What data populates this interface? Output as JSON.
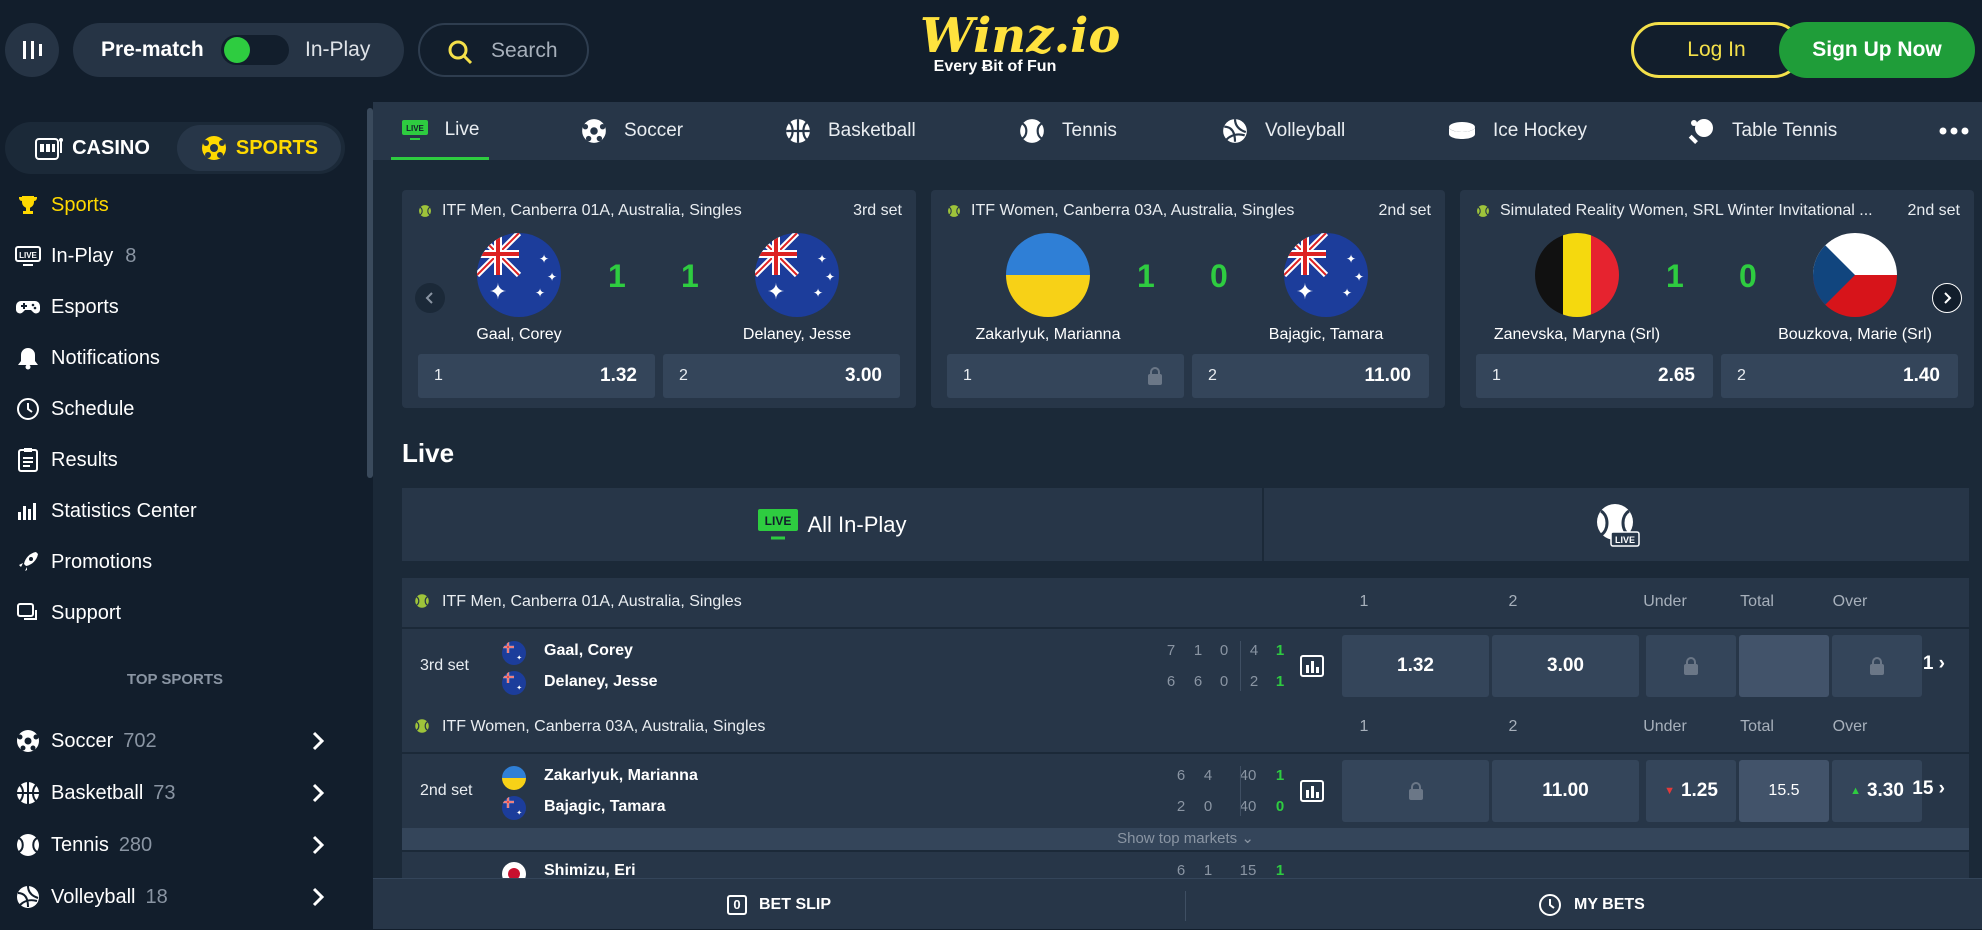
{
  "header": {
    "prematch_label": "Pre-match",
    "inplay_label": "In-Play",
    "search_label": "Search",
    "logo_text": "Winz.io",
    "logo_tagline": "Every Ƀit of Fun",
    "login_label": "Log In",
    "signup_label": "Sign Up Now"
  },
  "sidebar": {
    "casino_label": "CASINO",
    "sports_label": "SPORTS",
    "items": [
      {
        "label": "Sports",
        "count": ""
      },
      {
        "label": "In-Play",
        "count": "8"
      },
      {
        "label": "Esports",
        "count": ""
      },
      {
        "label": "Notifications",
        "count": ""
      },
      {
        "label": "Schedule",
        "count": ""
      },
      {
        "label": "Results",
        "count": ""
      },
      {
        "label": "Statistics Center",
        "count": ""
      },
      {
        "label": "Promotions",
        "count": ""
      },
      {
        "label": "Support",
        "count": ""
      }
    ],
    "top_sports_title": "TOP SPORTS",
    "top_sports": [
      {
        "label": "Soccer",
        "count": "702"
      },
      {
        "label": "Basketball",
        "count": "73"
      },
      {
        "label": "Tennis",
        "count": "280"
      },
      {
        "label": "Volleyball",
        "count": "18"
      }
    ]
  },
  "sport_nav": [
    "Live",
    "Soccer",
    "Basketball",
    "Tennis",
    "Volleyball",
    "Ice Hockey",
    "Table Tennis"
  ],
  "featured": [
    {
      "league": "ITF Men, Canberra 01A, Australia, Singles",
      "set": "3rd set",
      "p1": "Gaal, Corey",
      "p2": "Delaney, Jesse",
      "s1": "1",
      "s2": "1",
      "o1n": "1",
      "o1": "1.32",
      "o2n": "2",
      "o2": "3.00"
    },
    {
      "league": "ITF Women, Canberra 03A, Australia, Singles",
      "set": "2nd set",
      "p1": "Zakarlyuk, Marianna",
      "p2": "Bajagic, Tamara",
      "s1": "1",
      "s2": "0",
      "o1n": "1",
      "o1": "",
      "o2n": "2",
      "o2": "11.00"
    },
    {
      "league": "Simulated Reality Women, SRL Winter Invitational ...",
      "set": "2nd set",
      "p1": "Zanevska, Maryna (Srl)",
      "p2": "Bouzkova, Marie (Srl)",
      "s1": "1",
      "s2": "0",
      "o1n": "1",
      "o1": "2.65",
      "o2n": "2",
      "o2": "1.40"
    }
  ],
  "live_section": {
    "title": "Live",
    "all_inplay_label": "All In-Play",
    "live_badge": "LIVE",
    "col_1": "1",
    "col_2": "2",
    "col_under": "Under",
    "col_total": "Total",
    "col_over": "Over",
    "matches": [
      {
        "league": "ITF Men, Canberra 01A, Australia, Singles",
        "set": "3rd set",
        "p1": "Gaal, Corey",
        "p2": "Delaney, Jesse",
        "p1_scores": [
          "7",
          "1",
          "0",
          "4",
          "1"
        ],
        "p2_scores": [
          "6",
          "6",
          "0",
          "2",
          "1"
        ],
        "odd1": "1.32",
        "odd2": "3.00",
        "under": "",
        "total": "",
        "over": "",
        "more": "1"
      },
      {
        "league": "ITF Women, Canberra 03A, Australia, Singles",
        "set": "2nd set",
        "p1": "Zakarlyuk, Marianna",
        "p2": "Bajagic, Tamara",
        "p1_scores": [
          "6",
          "4",
          "40",
          "1"
        ],
        "p2_scores": [
          "2",
          "0",
          "40",
          "0"
        ],
        "odd1": "",
        "odd2": "11.00",
        "under": "1.25",
        "total": "15.5",
        "over": "3.30",
        "more": "15"
      }
    ],
    "show_top_markets": "Show top markets",
    "next_player": "Shimizu, Eri",
    "next_scores": [
      "6",
      "1",
      "15",
      "1"
    ]
  },
  "footer": {
    "betslip_count": "0",
    "betslip_label": "BET SLIP",
    "mybets_label": "MY BETS"
  },
  "colors": {
    "accent_yellow": "#ffd900",
    "green": "#2ecc40",
    "bg": "#121e2c",
    "panel": "#273648"
  }
}
